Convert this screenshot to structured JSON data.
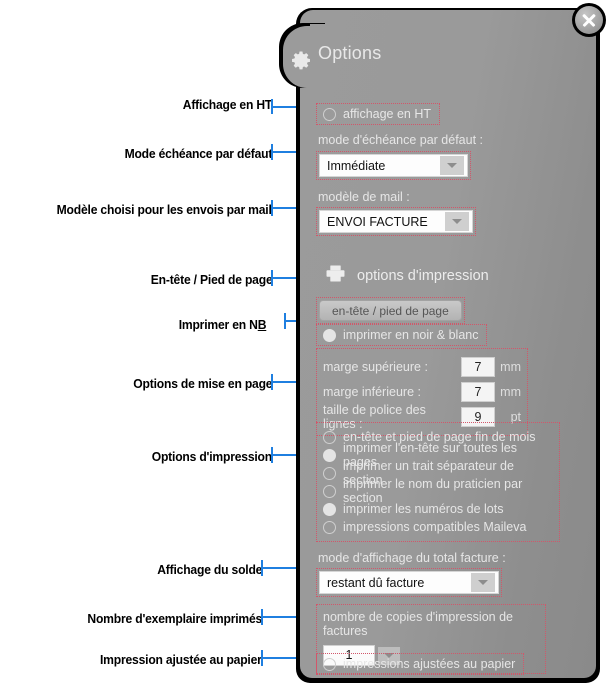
{
  "window": {
    "title": "Options",
    "gear_icon": "gear-icon",
    "close_icon": "close-icon"
  },
  "general": {
    "display_ht": {
      "label": "affichage en HT",
      "checked": false
    },
    "due_mode_label": "mode d'échéance par défaut :",
    "due_mode_value": "Immédiate",
    "mail_template_label": "modèle de mail :",
    "mail_template_value": "ENVOI FACTURE"
  },
  "print": {
    "section_title": "options d'impression",
    "section_icon": "printer-icon",
    "header_footer_button": "en-tête / pied de page",
    "black_white": {
      "label": "imprimer en noir & blanc",
      "checked": true
    },
    "margins": [
      {
        "label": "marge supérieure :",
        "value": "7",
        "unit": "mm"
      },
      {
        "label": "marge inférieure :",
        "value": "7",
        "unit": "mm"
      },
      {
        "label": "taille de police des lignes :",
        "value": "9",
        "unit": "pt"
      }
    ],
    "checkboxes": [
      {
        "label": "en-tête et pied de page fin de mois",
        "checked": false
      },
      {
        "label": "imprimer l'en-tête sur toutes les pages",
        "checked": true
      },
      {
        "label": "imprimer un trait séparateur de section",
        "checked": false
      },
      {
        "label": "imprimer le nom du praticien par section",
        "checked": false
      },
      {
        "label": "imprimer les numéros de lots",
        "checked": true
      },
      {
        "label": "impressions compatibles Maileva",
        "checked": false
      }
    ],
    "total_mode_label": "mode d'affichage du total facture :",
    "total_mode_value": "restant dû facture",
    "copies_label": "nombre de copies d'impression de factures",
    "copies_value": "1",
    "fit_paper": {
      "label": "impressions ajustées au papier",
      "checked": false
    }
  },
  "annotations": [
    {
      "text": "Affichage en HT"
    },
    {
      "text": "Mode échéance par défaut"
    },
    {
      "text": "Modèle choisi pour les envois par mail"
    },
    {
      "text": "En-tête / Pied de page"
    },
    {
      "text": "Imprimer en N",
      "underlined": "B"
    },
    {
      "text": "Options de mise en page"
    },
    {
      "text": "Options d'impression"
    },
    {
      "text": "Affichage du solde"
    },
    {
      "text": "Nombre d'exemplaire imprimés"
    },
    {
      "text": "Impression ajustée au papier"
    }
  ],
  "colors": {
    "panel": "#9a9a9a",
    "accent_line": "#1f7fe0",
    "dotted_highlight": "#d2566a",
    "text_light": "#e6e6e6"
  }
}
